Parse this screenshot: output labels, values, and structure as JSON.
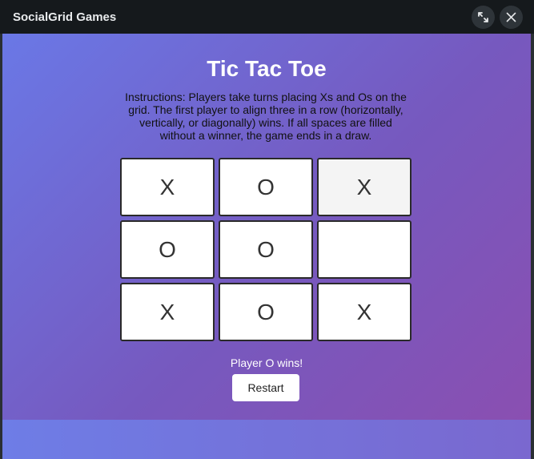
{
  "window": {
    "title": "SocialGrid Games",
    "buttons": [
      {
        "icon": "expand-icon"
      },
      {
        "icon": "close-icon"
      }
    ]
  },
  "game": {
    "title": "Tic Tac Toe",
    "instructions": "Instructions: Players take turns placing Xs and Os on the grid. The first player to align three in a row (horizontally, vertically, or diagonally) wins. If all spaces are filled without a winner, the game ends in a draw.",
    "board": [
      [
        "X",
        "O",
        "X"
      ],
      [
        "O",
        "O",
        ""
      ],
      [
        "X",
        "O",
        "X"
      ]
    ],
    "status": "Player O wins!",
    "restart_label": "Restart"
  },
  "colors": {
    "titlebar": "#15191c",
    "gradient_start": "#6a78e6",
    "gradient_end": "#8a4fb1",
    "cell": "#ffffff"
  }
}
